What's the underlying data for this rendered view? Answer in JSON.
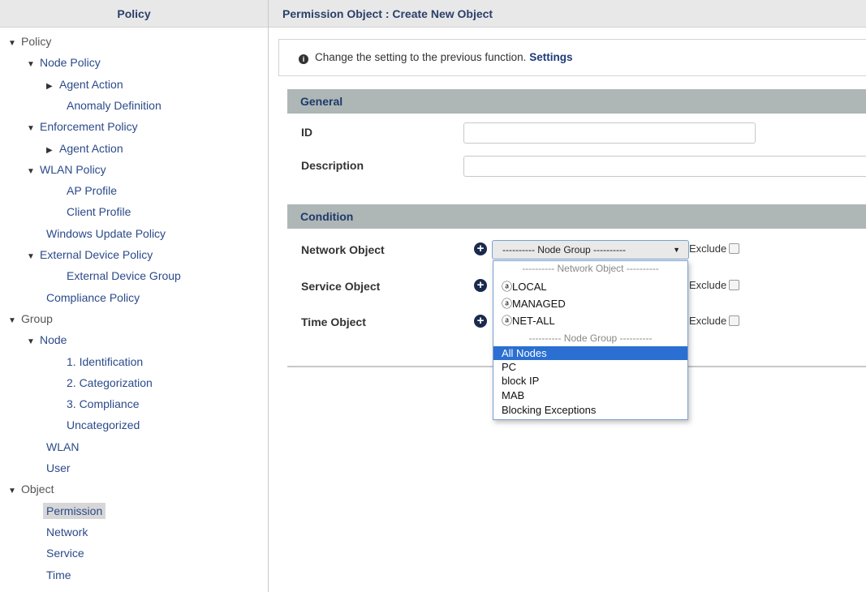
{
  "sidebar": {
    "title": "Policy",
    "items": [
      {
        "label": "Policy",
        "toggle": "down",
        "level": 0
      },
      {
        "label": "Node Policy",
        "toggle": "down",
        "level": 1
      },
      {
        "label": "Agent Action",
        "toggle": "right",
        "level": 2
      },
      {
        "label": "Anomaly Definition",
        "toggle": "",
        "level": 3
      },
      {
        "label": "Enforcement Policy",
        "toggle": "down",
        "level": 1
      },
      {
        "label": "Agent Action",
        "toggle": "right",
        "level": 2
      },
      {
        "label": "WLAN Policy",
        "toggle": "down",
        "level": 1
      },
      {
        "label": "AP Profile",
        "toggle": "",
        "level": 3
      },
      {
        "label": "Client Profile",
        "toggle": "",
        "level": 3
      },
      {
        "label": "Windows Update Policy",
        "toggle": "",
        "level": 2
      },
      {
        "label": "External Device Policy",
        "toggle": "down",
        "level": 1
      },
      {
        "label": "External Device Group",
        "toggle": "",
        "level": 3
      },
      {
        "label": "Compliance Policy",
        "toggle": "",
        "level": 2
      },
      {
        "label": "Group",
        "toggle": "down",
        "level": 0
      },
      {
        "label": "Node",
        "toggle": "down",
        "level": 1
      },
      {
        "label": "1. Identification",
        "toggle": "",
        "level": 3
      },
      {
        "label": "2. Categorization",
        "toggle": "",
        "level": 3
      },
      {
        "label": "3. Compliance",
        "toggle": "",
        "level": 3
      },
      {
        "label": "Uncategorized",
        "toggle": "",
        "level": 3
      },
      {
        "label": "WLAN",
        "toggle": "",
        "level": 2
      },
      {
        "label": "User",
        "toggle": "",
        "level": 2
      },
      {
        "label": "Object",
        "toggle": "down",
        "level": 0
      },
      {
        "label": "Permission",
        "toggle": "",
        "level": 2,
        "selected": true
      },
      {
        "label": "Network",
        "toggle": "",
        "level": 2
      },
      {
        "label": "Service",
        "toggle": "",
        "level": 2
      },
      {
        "label": "Time",
        "toggle": "",
        "level": 2
      }
    ]
  },
  "main": {
    "title": "Permission Object : Create New Object",
    "info": {
      "text": "Change the setting to the previous function.",
      "link": "Settings"
    },
    "general": {
      "title": "General",
      "id_label": "ID",
      "id_value": "",
      "description_label": "Description",
      "description_value": ""
    },
    "condition": {
      "title": "Condition",
      "network_label": "Network Object",
      "service_label": "Service Object",
      "time_label": "Time Object",
      "network_selected": "---------- Node Group ----------",
      "exclude_label": "Exclude"
    },
    "dropdown": {
      "options": [
        {
          "label": "---------- Network Object ----------",
          "type": "group"
        },
        {
          "label": "ⓐLOCAL",
          "type": "option"
        },
        {
          "label": "ⓐMANAGED",
          "type": "option"
        },
        {
          "label": "ⓐNET-ALL",
          "type": "option"
        },
        {
          "label": "---------- Node Group ----------",
          "type": "group"
        },
        {
          "label": "All Nodes",
          "type": "option",
          "selected": true
        },
        {
          "label": "PC",
          "type": "option"
        },
        {
          "label": "block IP",
          "type": "option"
        },
        {
          "label": "MAB",
          "type": "option"
        },
        {
          "label": "Blocking Exceptions",
          "type": "option"
        }
      ]
    }
  },
  "colors": {
    "header_bg": "#e8e8e8",
    "section_bg": "#aeb6b6",
    "link": "#2b4a8a",
    "selection": "#2a6fd1"
  }
}
